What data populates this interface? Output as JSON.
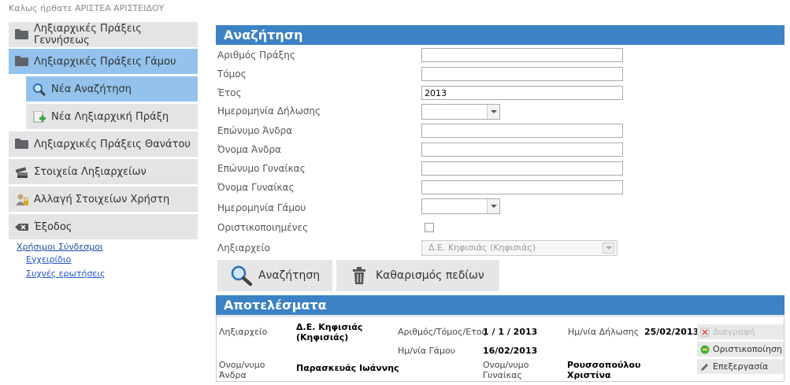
{
  "welcome": "Καλως ήρθατε ΑΡΙΣΤΕΑ ΑΡΙΣΤΕΙΔΟΥ",
  "nav": {
    "birth": "Ληξιαρχικές Πράξεις Γεννήσεως",
    "marriage": "Ληξιαρχικές Πράξεις Γάμου",
    "new_search": "Νέα Αναζήτηση",
    "new_act": "Νέα Ληξιαρχική Πράξη",
    "death": "Ληξιαρχικές Πράξεις Θανάτου",
    "registry_info": "Στοιχεία Ληξιαρχείων",
    "user_info": "Αλλαγή Στοιχείων Χρήστη",
    "exit": "Έξοδος"
  },
  "links": {
    "title": "Χρήσιμοι Σύνδεσμοι",
    "manual": "Εγχειρίδιο",
    "faq": "Συχνές ερωτήσεις"
  },
  "search": {
    "header": "Αναζήτηση",
    "labels": {
      "act_number": "Αριθμός Πράξης",
      "volume": "Τόμος",
      "year": "Έτος",
      "declaration_date": "Ημερομηνία Δήλωσης",
      "husband_surname": "Επώνυμο Άνδρα",
      "husband_name": "Όνομα Άνδρα",
      "wife_surname": "Επώνυμο Γυναίκας",
      "wife_name": "Όνομα Γυναίκας",
      "marriage_date": "Ημερομηνία Γάμου",
      "finalized": "Οριστικοποιημένες",
      "registry": "Ληξιαρχείο"
    },
    "values": {
      "act_number": "",
      "volume": "",
      "year": "2013",
      "husband_surname": "",
      "husband_name": "",
      "wife_surname": "",
      "wife_name": ""
    },
    "registry_selected": "Δ.Ε. Κηφισιάς (Κηφισιάς)",
    "search_button": "Αναζήτηση",
    "clear_button": "Καθαρισμός πεδίων"
  },
  "results": {
    "header": "Αποτελέσματα",
    "row": {
      "registry_label": "Ληξιαρχείο",
      "registry_value_1": "Δ.Ε. Κηφισιάς",
      "registry_value_2": "(Κηφισιάς)",
      "number_label": "Αριθμός/Τόμος/Ετος",
      "number_value": "1 / 1 / 2013",
      "decl_label": "Ημ/νία Δήλωσης",
      "decl_value": "25/02/2013",
      "marriage_label": "Ημ/νία Γάμου",
      "marriage_value": "16/02/2013",
      "husband_label_1": "Ονομ/νυμο",
      "husband_label_2": "Άνδρα",
      "husband_value": "Παρασκευάς Ιωάννης",
      "wife_label_1": "Ονομ/νυμο",
      "wife_label_2": "Γυναίκας",
      "wife_value_1": "Ρουσσοπούλου",
      "wife_value_2": "Χριστίνα"
    },
    "actions": {
      "delete": "Διαγραφή",
      "finalize": "Οριστικοποίηση",
      "edit": "Επεξεργασία"
    }
  },
  "colors": {
    "header_blue": "#3c82c4",
    "active_nav": "#93c3ec",
    "nav_bg": "#e4e4e4"
  }
}
